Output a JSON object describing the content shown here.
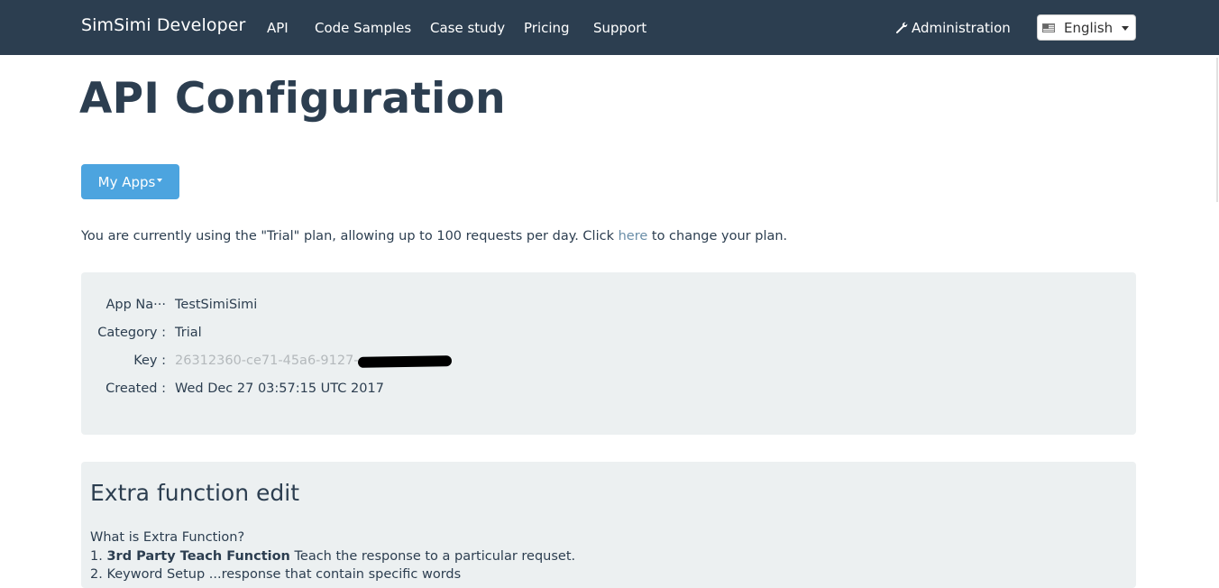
{
  "nav": {
    "brand": "SimSimi Developer",
    "links": [
      "API",
      "Code Samples",
      "Case study",
      "Pricing",
      "Support"
    ],
    "admin_label": "Administration",
    "language": "English"
  },
  "page": {
    "title": "API Configuration",
    "my_apps_label": "My Apps",
    "plan_text_before": "You are currently using the \"Trial\" plan, allowing up to 100 requests per day. Click ",
    "plan_link": "here",
    "plan_text_after": " to change your plan."
  },
  "app_info": {
    "rows": [
      {
        "label": "App Na···",
        "value": "TestSimiSimi"
      },
      {
        "label": "Category :",
        "value": "Trial"
      },
      {
        "label": "Key :",
        "value": "26312360-ce71-45a6-9127-"
      },
      {
        "label": "Created :",
        "value": "Wed Dec 27 03:57:15 UTC 2017"
      }
    ]
  },
  "extra": {
    "title": "Extra function edit",
    "question": "What is Extra Function?",
    "item1_prefix": "1. ",
    "item1_strong": "3rd Party Teach Function",
    "item1_text": " Teach the response to a particular requset.",
    "item2_text": "2. Keyword Setup ...response that contain specific words"
  },
  "colors": {
    "navbar": "#2c3e50",
    "primary_button": "#3498db",
    "well": "#ecf0f1"
  }
}
